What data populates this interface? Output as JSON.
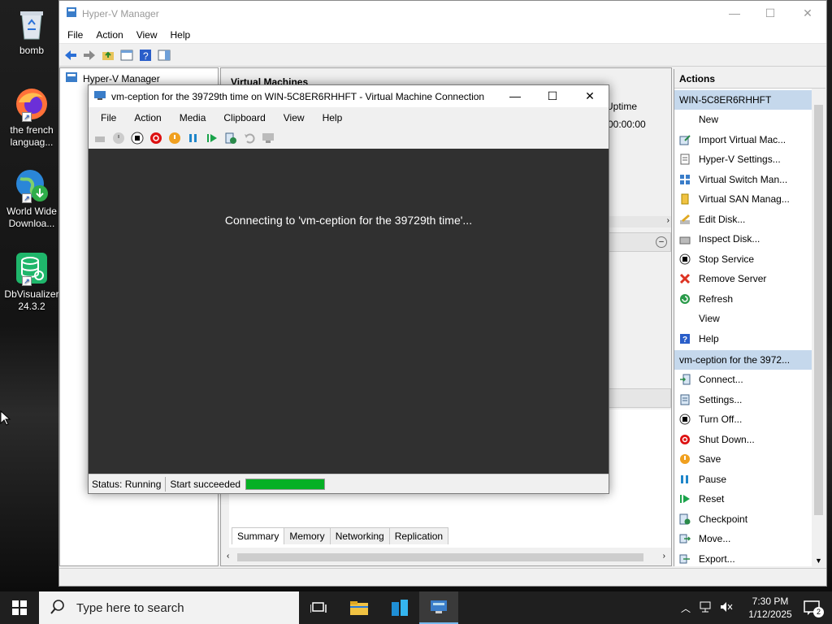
{
  "desktop": {
    "icons": [
      {
        "label": "bomb",
        "icon": "recycle-bin-icon"
      },
      {
        "label": "the french languag...",
        "icon": "firefox-icon"
      },
      {
        "label": "World Wide Downloa...",
        "icon": "globe-download-icon"
      },
      {
        "label": "DbVisualizer 24.3.2",
        "icon": "database-icon"
      }
    ]
  },
  "hyperv": {
    "title": "Hyper-V Manager",
    "menu": [
      "File",
      "Action",
      "View",
      "Help"
    ],
    "tree_root": "Hyper-V Manager",
    "center": {
      "section_title": "Virtual Machines",
      "col_uptime": "Uptime",
      "uptime_value": "00:00:00",
      "tabs": [
        "Summary",
        "Memory",
        "Networking",
        "Replication"
      ]
    },
    "actions": {
      "header": "Actions",
      "server_section": "WIN-5C8ER6RHHFT",
      "server_items": [
        {
          "label": "New",
          "icon": "new-icon",
          "submenu": true
        },
        {
          "label": "Import Virtual Mac...",
          "icon": "import-icon"
        },
        {
          "label": "Hyper-V Settings...",
          "icon": "settings-page-icon"
        },
        {
          "label": "Virtual Switch Man...",
          "icon": "switch-icon"
        },
        {
          "label": "Virtual SAN Manag...",
          "icon": "san-icon"
        },
        {
          "label": "Edit Disk...",
          "icon": "edit-disk-icon"
        },
        {
          "label": "Inspect Disk...",
          "icon": "inspect-disk-icon"
        },
        {
          "label": "Stop Service",
          "icon": "stop-icon"
        },
        {
          "label": "Remove Server",
          "icon": "remove-icon"
        },
        {
          "label": "Refresh",
          "icon": "refresh-icon"
        },
        {
          "label": "View",
          "icon": "none",
          "submenu": true
        },
        {
          "label": "Help",
          "icon": "help-icon"
        }
      ],
      "vm_section": "vm-ception for the 3972...",
      "vm_items": [
        {
          "label": "Connect...",
          "icon": "connect-icon"
        },
        {
          "label": "Settings...",
          "icon": "vm-settings-icon"
        },
        {
          "label": "Turn Off...",
          "icon": "turn-off-icon"
        },
        {
          "label": "Shut Down...",
          "icon": "shut-down-icon"
        },
        {
          "label": "Save",
          "icon": "save-icon"
        },
        {
          "label": "Pause",
          "icon": "pause-icon"
        },
        {
          "label": "Reset",
          "icon": "reset-icon"
        },
        {
          "label": "Checkpoint",
          "icon": "checkpoint-icon"
        },
        {
          "label": "Move...",
          "icon": "move-icon"
        },
        {
          "label": "Export...",
          "icon": "export-icon"
        }
      ]
    }
  },
  "vmconn": {
    "title": "vm-ception for the 39729th time on WIN-5C8ER6RHHFT - Virtual Machine Connection",
    "menu": [
      "File",
      "Action",
      "Media",
      "Clipboard",
      "View",
      "Help"
    ],
    "screen_message": "Connecting to 'vm-ception for the 39729th time'...",
    "status": "Status: Running",
    "status_detail": "Start succeeded",
    "progress": 1.0
  },
  "taskbar": {
    "search_placeholder": "Type here to search",
    "time": "7:30 PM",
    "date": "1/12/2025",
    "notification_count": "2"
  },
  "colors": {
    "accent": "#c5d8ec",
    "progress": "#06b025",
    "vm_screen": "#303030"
  }
}
